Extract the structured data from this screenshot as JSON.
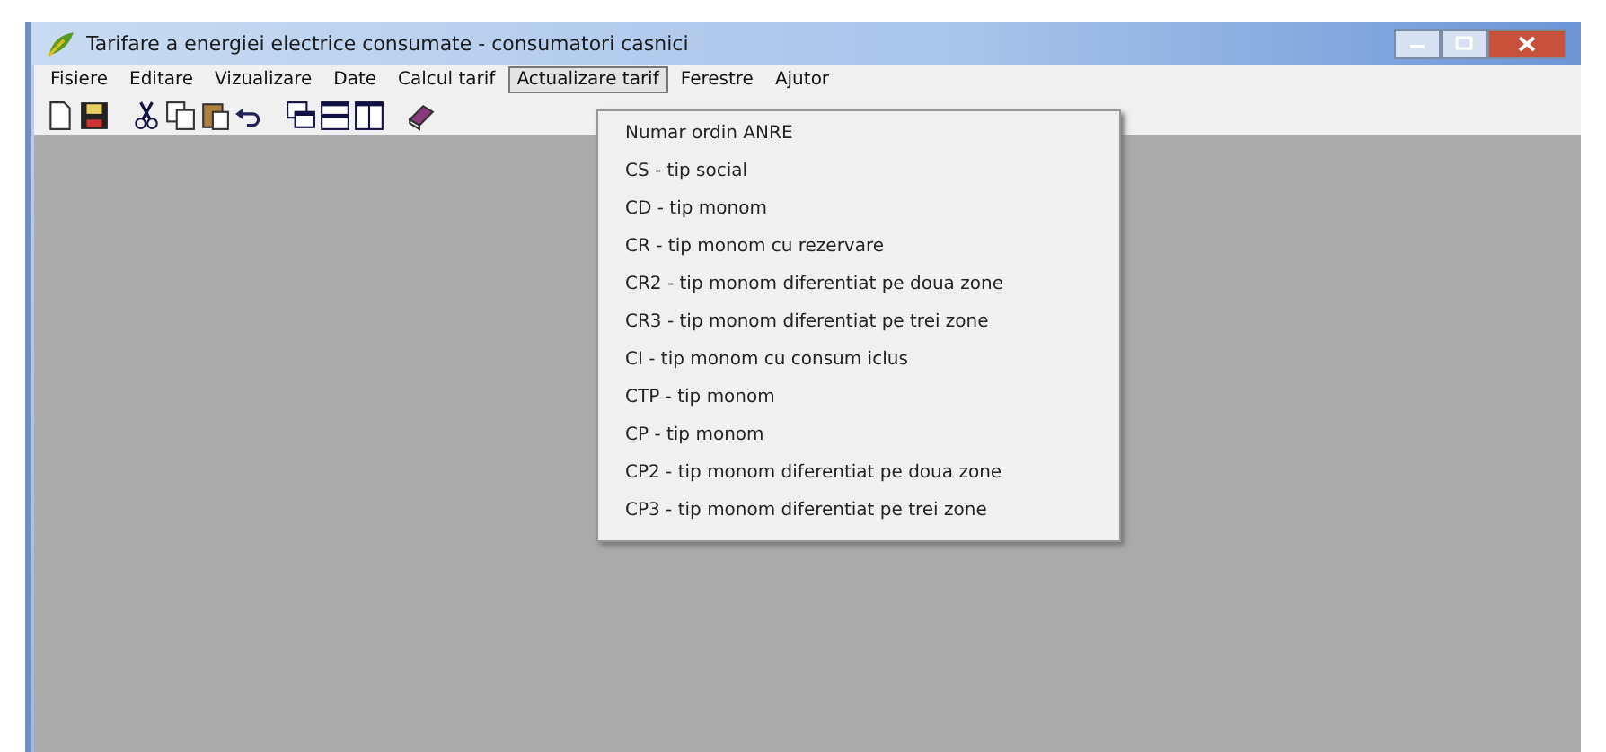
{
  "window": {
    "title": "Tarifare a energiei electrice consumate - consumatori casnici"
  },
  "menu": [
    {
      "label": "Fisiere",
      "selected": false
    },
    {
      "label": "Editare",
      "selected": false
    },
    {
      "label": "Vizualizare",
      "selected": false
    },
    {
      "label": "Date",
      "selected": false
    },
    {
      "label": "Calcul tarif",
      "selected": false
    },
    {
      "label": "Actualizare tarif",
      "selected": true
    },
    {
      "label": "Ferestre",
      "selected": false
    },
    {
      "label": "Ajutor",
      "selected": false
    }
  ],
  "dropdown": {
    "items": [
      "Numar ordin ANRE",
      "CS - tip social",
      "CD - tip monom",
      "CR - tip monom cu rezervare",
      "CR2 - tip monom diferentiat pe doua zone",
      "CR3 - tip monom diferentiat pe trei zone",
      "CI - tip monom cu consum iclus",
      "CTP - tip monom",
      "CP - tip monom",
      "CP2 - tip monom diferentiat pe doua zone",
      "CP3 - tip monom diferentiat pe trei zone"
    ]
  }
}
